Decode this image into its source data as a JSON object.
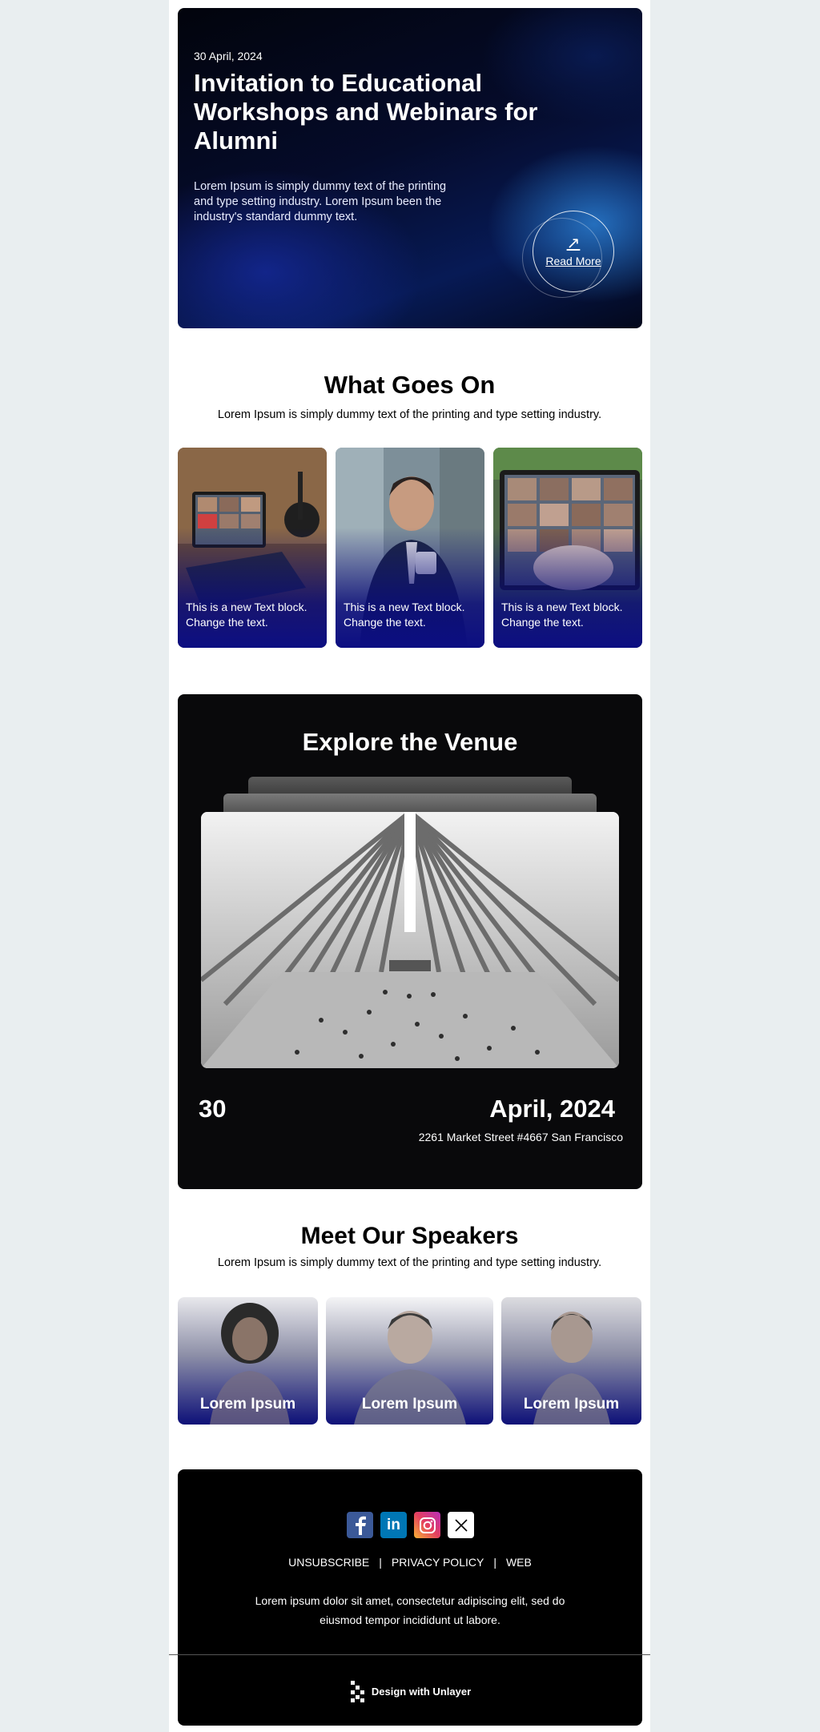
{
  "hero": {
    "date": "30 April, 2024",
    "title": "Invitation to Educational Workshops and Webinars for Alumni",
    "text": "Lorem Ipsum is simply dummy text of the printing and type setting industry. Lorem Ipsum been the industry's standard dummy text.",
    "cta": "Read More",
    "cta_icon": "arrow-up-right-icon"
  },
  "what_goes_on": {
    "title": "What Goes On",
    "subtitle": "Lorem Ipsum is simply dummy text of the printing and type setting industry.",
    "cards": [
      {
        "text": "This is a new Text block. Change the text."
      },
      {
        "text": "This is a new Text block. Change the text."
      },
      {
        "text": "This is a new Text block. Change the text."
      }
    ]
  },
  "venue": {
    "title": "Explore the Venue",
    "day": "30",
    "month_year": "April, 2024",
    "address": "2261 Market Street #4667 San Francisco"
  },
  "speakers": {
    "title": "Meet Our Speakers",
    "subtitle": "Lorem Ipsum is simply dummy text of the printing and type setting industry.",
    "items": [
      {
        "name": "Lorem Ipsum"
      },
      {
        "name": "Lorem Ipsum"
      },
      {
        "name": "Lorem Ipsum"
      }
    ]
  },
  "footer": {
    "social": [
      "facebook-icon",
      "linkedin-icon",
      "instagram-icon",
      "x-icon"
    ],
    "links": [
      "UNSUBSCRIBE",
      "PRIVACY POLICY",
      "WEB"
    ],
    "separator": "|",
    "text": "Lorem ipsum dolor sit amet, consectetur adipiscing elit, sed do eiusmod tempor incididunt ut labore.",
    "brand": "Design with Unlayer"
  },
  "colors": {
    "page_bg": "#e9eef0",
    "card_gradient": "#0c0e82",
    "venue_bg": "#09090b",
    "footer_bg": "#000000"
  }
}
